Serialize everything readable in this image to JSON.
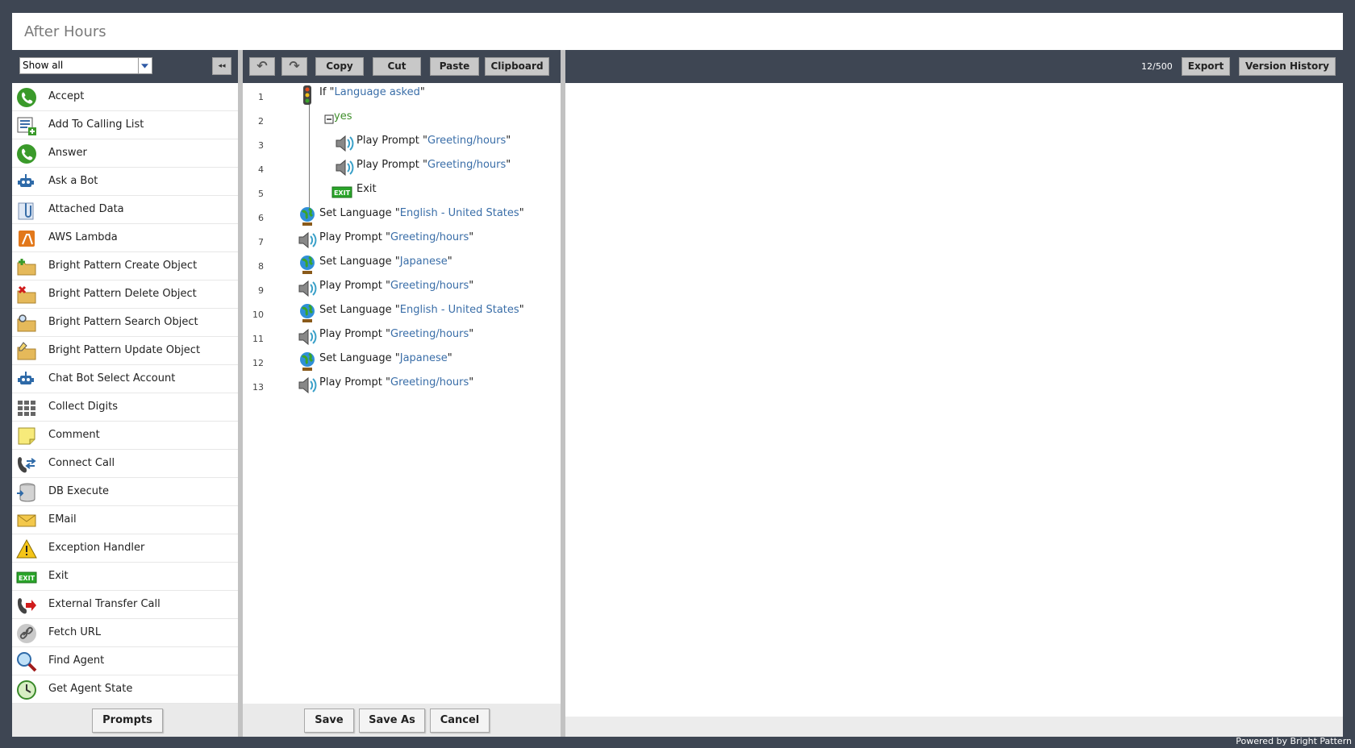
{
  "window": {
    "title": "After Hours"
  },
  "palette": {
    "filter": {
      "value": "Show all"
    },
    "collapse_label": "◂◂",
    "blocks": [
      {
        "label": "Accept",
        "icon": "phone-green-icon"
      },
      {
        "label": "Add To Calling List",
        "icon": "list-add-icon"
      },
      {
        "label": "Answer",
        "icon": "phone-green-icon"
      },
      {
        "label": "Ask a Bot",
        "icon": "robot-icon"
      },
      {
        "label": "Attached Data",
        "icon": "paperclip-icon"
      },
      {
        "label": "AWS Lambda",
        "icon": "aws-lambda-icon"
      },
      {
        "label": "Bright Pattern Create Object",
        "icon": "folder-add-icon"
      },
      {
        "label": "Bright Pattern Delete Object",
        "icon": "folder-delete-icon"
      },
      {
        "label": "Bright Pattern Search Object",
        "icon": "folder-search-icon"
      },
      {
        "label": "Bright Pattern Update Object",
        "icon": "folder-edit-icon"
      },
      {
        "label": "Chat Bot Select Account",
        "icon": "robot-icon"
      },
      {
        "label": "Collect Digits",
        "icon": "keypad-icon"
      },
      {
        "label": "Comment",
        "icon": "note-icon"
      },
      {
        "label": "Connect Call",
        "icon": "connect-call-icon"
      },
      {
        "label": "DB Execute",
        "icon": "database-icon"
      },
      {
        "label": "EMail",
        "icon": "envelope-icon"
      },
      {
        "label": "Exception Handler",
        "icon": "warning-icon"
      },
      {
        "label": "Exit",
        "icon": "exit-icon"
      },
      {
        "label": "External Transfer Call",
        "icon": "transfer-call-icon"
      },
      {
        "label": "Fetch URL",
        "icon": "link-icon"
      },
      {
        "label": "Find Agent",
        "icon": "magnifier-icon"
      },
      {
        "label": "Get Agent State",
        "icon": "clock-icon"
      }
    ],
    "prompts_label": "Prompts"
  },
  "toolbar": {
    "undo_label": "↶",
    "redo_label": "↷",
    "copy_label": "Copy",
    "cut_label": "Cut",
    "paste_label": "Paste",
    "clipboard_label": "Clipboard",
    "counter": "12/500",
    "export_label": "Export",
    "version_history_label": "Version History"
  },
  "flow": {
    "rows": [
      {
        "num": "1",
        "icon": "traffic-light-icon",
        "prefix": "If \"",
        "value": "Language asked",
        "suffix": "\""
      },
      {
        "num": "2",
        "icon": "collapse-icon",
        "prefix": "yes",
        "value": "",
        "suffix": ""
      },
      {
        "num": "3",
        "icon": "speaker-icon",
        "prefix": "Play Prompt \"",
        "value": "Greeting/hours",
        "suffix": "\""
      },
      {
        "num": "4",
        "icon": "speaker-icon",
        "prefix": "Play Prompt \"",
        "value": "Greeting/hours",
        "suffix": "\""
      },
      {
        "num": "5",
        "icon": "exit-icon",
        "prefix": "Exit",
        "value": "",
        "suffix": ""
      },
      {
        "num": "6",
        "icon": "globe-icon",
        "prefix": "Set Language \"",
        "value": "English - United States",
        "suffix": "\""
      },
      {
        "num": "7",
        "icon": "speaker-icon",
        "prefix": "Play Prompt \"",
        "value": "Greeting/hours",
        "suffix": "\""
      },
      {
        "num": "8",
        "icon": "globe-icon",
        "prefix": "Set Language \"",
        "value": "Japanese",
        "suffix": "\""
      },
      {
        "num": "9",
        "icon": "speaker-icon",
        "prefix": "Play Prompt \"",
        "value": "Greeting/hours",
        "suffix": "\""
      },
      {
        "num": "10",
        "icon": "globe-icon",
        "prefix": "Set Language \"",
        "value": "English - United States",
        "suffix": "\""
      },
      {
        "num": "11",
        "icon": "speaker-icon",
        "prefix": "Play Prompt \"",
        "value": "Greeting/hours",
        "suffix": "\""
      },
      {
        "num": "12",
        "icon": "globe-icon",
        "prefix": "Set Language \"",
        "value": "Japanese",
        "suffix": "\""
      },
      {
        "num": "13",
        "icon": "speaker-icon",
        "prefix": "Play Prompt \"",
        "value": "Greeting/hours",
        "suffix": "\""
      }
    ]
  },
  "editor_actions": {
    "save_label": "Save",
    "save_as_label": "Save As",
    "cancel_label": "Cancel"
  },
  "footer": "Powered by Bright Pattern"
}
